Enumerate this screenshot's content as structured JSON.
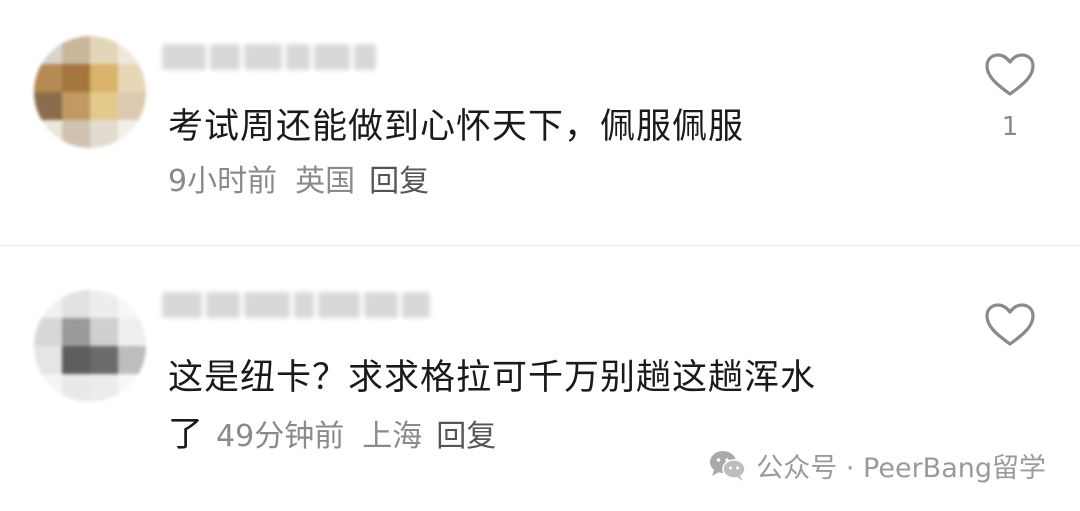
{
  "comments": [
    {
      "text": "考试周还能做到心怀天下，佩服佩服",
      "text_cont": "",
      "time": "9小时前",
      "location": "英国",
      "reply_label": "回复",
      "like_count": "1"
    },
    {
      "text": "这是纽卡？求求格拉可千万别趟这趟浑水",
      "text_cont": "了",
      "time": "49分钟前",
      "location": "上海",
      "reply_label": "回复",
      "like_count": ""
    }
  ],
  "watermark": {
    "text": "公众号 · PeerBang留学"
  },
  "icons": {
    "like": "heart-outline-icon",
    "watermark": "wechat-icon"
  },
  "colors": {
    "text": "#1a1a1a",
    "meta": "#8a8a8a",
    "divider": "#ededed"
  }
}
